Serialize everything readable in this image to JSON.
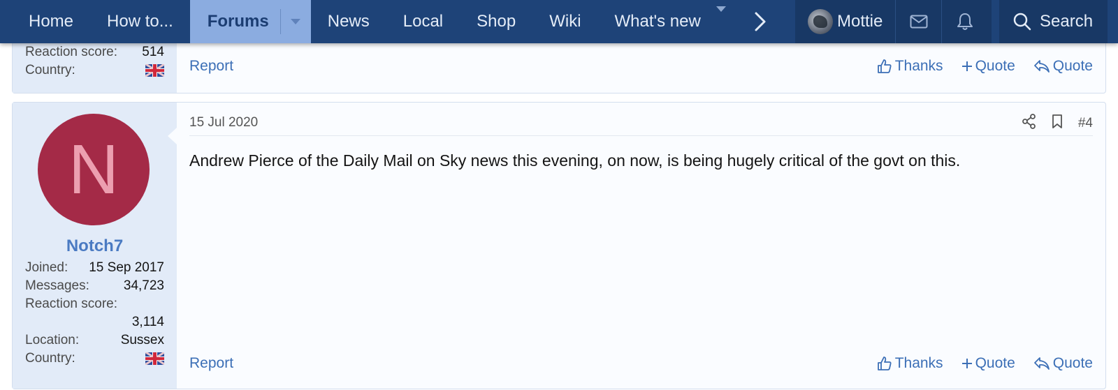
{
  "nav": {
    "items": [
      "Home",
      "How to...",
      "Forums",
      "News",
      "Local",
      "Shop",
      "Wiki",
      "What's new"
    ],
    "user_name": "Mottie",
    "search_label": "Search"
  },
  "prev_post": {
    "stats": [
      {
        "label": "Reaction score:",
        "value": "514"
      },
      {
        "label": "Country:",
        "value": ""
      }
    ],
    "report_label": "Report",
    "actions": [
      "Thanks",
      "Quote",
      "Quote"
    ]
  },
  "post": {
    "avatar_letter": "N",
    "username": "Notch7",
    "stats": [
      {
        "label": "Joined:",
        "value": "15 Sep 2017"
      },
      {
        "label": "Messages:",
        "value": "34,723"
      },
      {
        "label": "Reaction score:",
        "value": ""
      },
      {
        "label": "",
        "value": "3,114"
      },
      {
        "label": "Location:",
        "value": "Sussex"
      },
      {
        "label": "Country:",
        "value": ""
      }
    ],
    "date": "15 Jul 2020",
    "number": "#4",
    "body": "Andrew Pierce of the Daily Mail on Sky news this evening, on now, is being hugely critical of the govt on this.",
    "report_label": "Report",
    "actions": [
      "Thanks",
      "Quote",
      "Quote"
    ]
  },
  "colors": {
    "nav_bg": "#1e4378",
    "nav_active_bg": "#8bace0",
    "link": "#3c6fb6",
    "avatar_bg": "#a42a47",
    "user_col_bg": "#e2ebf8"
  }
}
